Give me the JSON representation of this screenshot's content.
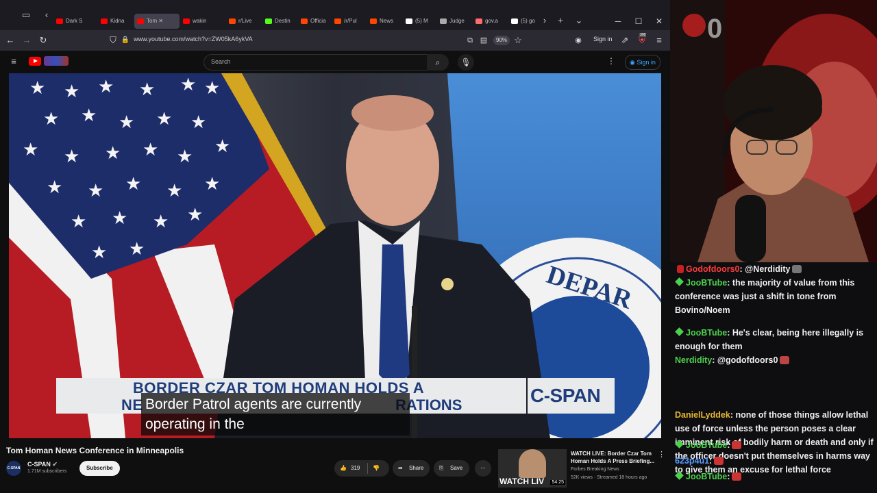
{
  "browser": {
    "tabs": [
      {
        "label": "Dark S",
        "favicon": "youtube-icon",
        "color": "#ff0000"
      },
      {
        "label": "Kidna",
        "favicon": "youtube-icon",
        "color": "#ff0000"
      },
      {
        "label": "Tom",
        "favicon": "youtube-icon",
        "color": "#ff0000",
        "active": true
      },
      {
        "label": "wakin",
        "favicon": "youtube-icon",
        "color": "#ff0000"
      },
      {
        "label": "r/Live",
        "favicon": "reddit-icon",
        "color": "#ff4500"
      },
      {
        "label": "Destin",
        "favicon": "kick-icon",
        "color": "#53fc18"
      },
      {
        "label": "Officia",
        "favicon": "reddit-icon",
        "color": "#ff4500"
      },
      {
        "label": "/r/Pul",
        "favicon": "reddit-icon",
        "color": "#ff4500"
      },
      {
        "label": "News",
        "favicon": "reddit-icon",
        "color": "#ff4500"
      },
      {
        "label": "(5) M",
        "favicon": "x-icon",
        "color": "#ffffff"
      },
      {
        "label": "Judge",
        "favicon": "page-icon",
        "color": "#aaaaaa"
      },
      {
        "label": "gov.a",
        "favicon": "warning-icon",
        "color": "#ff6a6a"
      },
      {
        "label": "(5) go",
        "favicon": "x-icon",
        "color": "#ffffff"
      }
    ],
    "url": "www.youtube.com/watch?v=ZW05kA6ykVA",
    "zoom": "90%",
    "signin": "Sign in",
    "badge_count": "308"
  },
  "youtube": {
    "search_placeholder": "Search",
    "signin": "Sign in",
    "video": {
      "lower_third_line1": "BORDER CZAR TOM HOMAN HOLDS A",
      "lower_third_line2_left": "NE",
      "lower_third_line2_right": "RATIONS",
      "network_logo": "C-SPAN",
      "seal_text": "DEPAR",
      "caption_line1": "Border Patrol agents are currently",
      "caption_line2": "operating in the"
    },
    "title": "Tom Homan News Conference in Minneapolis",
    "channel": {
      "name": "C-SPAN",
      "subscribers": "1.71M subscribers",
      "avatar_text": "C-SPAN"
    },
    "subscribe": "Subscribe",
    "likes": "319",
    "share": "Share",
    "save": "Save",
    "recommended": {
      "title": "WATCH LIVE: Border Czar Tom Homan Holds A Press Briefing...",
      "channel": "Forbes Breaking News",
      "meta": "52K views · Streamed 18 hours ago",
      "thumb_text": "WATCH LIV",
      "duration": "54:25"
    }
  },
  "stream": {
    "counter": "0",
    "chat": [
      {
        "badge": "sub",
        "user": "Godofdoors0",
        "user_color": "#ff3b3b",
        "text": ": @Nerdidity",
        "emote_after": true
      },
      {
        "badge": "gem",
        "user": "JooBTube",
        "user_color": "#4cd14c",
        "text": ": the majority of value from this conference was just a shift in tone from Bovino/Noem"
      },
      {
        "badge": "gem",
        "user": "JooBTube",
        "user_color": "#4cd14c",
        "text": ": He's clear, being here illegally is enough for them"
      },
      {
        "badge": "none",
        "user": "Nerdidity",
        "user_color": "#4cd14c",
        "text": ": @godofdoors0",
        "emote_after": true
      },
      {
        "badge": "none",
        "user": "DanielLyddek",
        "user_color": "#e8b830",
        "text": ": none of those things allow lethal use of force unless the person poses a clear imminent risk of bodily harm or death and only if the officer doesn't put themselves in harms way to give them an excuse for lethal force"
      },
      {
        "badge": "gem",
        "user": "JooBTube",
        "user_color": "#4cd14c",
        "text": ":",
        "emote_after": true
      },
      {
        "badge": "none",
        "user": "623p4u1",
        "user_color": "#5a9bff",
        "text": ":",
        "emote_after": true
      },
      {
        "badge": "gem",
        "user": "JooBTube",
        "user_color": "#4cd14c",
        "text": ":",
        "emote_after": true
      }
    ]
  }
}
